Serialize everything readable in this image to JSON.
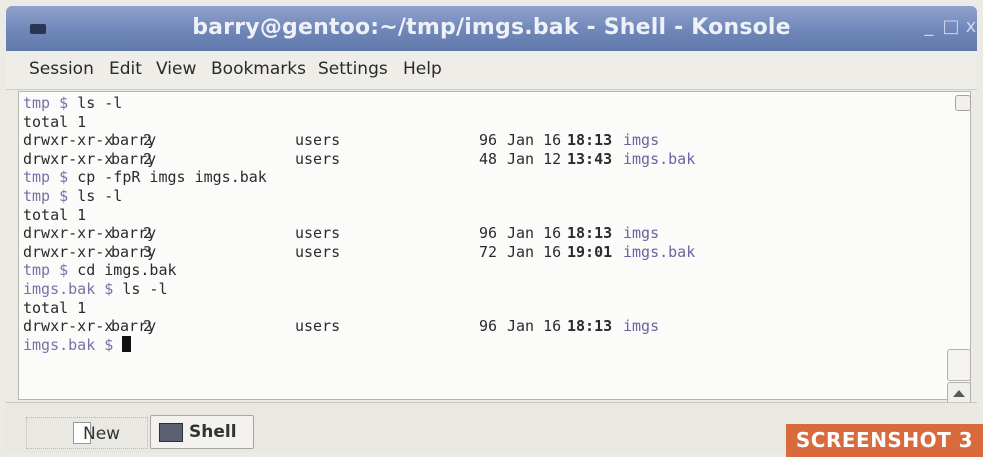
{
  "window": {
    "title": "barry@gentoo:~/tmp/imgs.bak - Shell - Konsole",
    "minimize": "_",
    "maximize": "□",
    "close": "x"
  },
  "menu": [
    "Session",
    "Edit",
    "View",
    "Bookmarks",
    "Settings",
    "Help"
  ],
  "terminal": {
    "lines": [
      {
        "prompt": "tmp $ ",
        "cmd": "ls -l"
      },
      {
        "text": "total 1"
      },
      {
        "perm": "drwxr-xr-x",
        "links": "2",
        "user": "barry",
        "group": "users",
        "size": "96",
        "date": "Jan 16",
        "time": "18:13",
        "name": "imgs"
      },
      {
        "perm": "drwxr-xr-x",
        "links": "2",
        "user": "barry",
        "group": "users",
        "size": "48",
        "date": "Jan 12",
        "time": "13:43",
        "name": "imgs.bak"
      },
      {
        "prompt": "tmp $ ",
        "cmd": "cp -fpR imgs imgs.bak"
      },
      {
        "prompt": "tmp $ ",
        "cmd": "ls -l"
      },
      {
        "text": "total 1"
      },
      {
        "perm": "drwxr-xr-x",
        "links": "2",
        "user": "barry",
        "group": "users",
        "size": "96",
        "date": "Jan 16",
        "time": "18:13",
        "name": "imgs"
      },
      {
        "perm": "drwxr-xr-x",
        "links": "3",
        "user": "barry",
        "group": "users",
        "size": "72",
        "date": "Jan 16",
        "time": "19:01",
        "name": "imgs.bak"
      },
      {
        "prompt": "tmp $ ",
        "cmd": "cd imgs.bak"
      },
      {
        "prompt": "imgs.bak $ ",
        "cmd": "ls -l"
      },
      {
        "text": "total 1"
      },
      {
        "perm": "drwxr-xr-x",
        "links": "2",
        "user": "barry",
        "group": "users",
        "size": "96",
        "date": "Jan 16",
        "time": "18:13",
        "name": "imgs"
      },
      {
        "prompt": "imgs.bak $ ",
        "cmd": "",
        "cursor": true
      }
    ]
  },
  "tabs": {
    "new_label": "New",
    "shell_label": "Shell"
  },
  "badge": "SCREENSHOT 3"
}
